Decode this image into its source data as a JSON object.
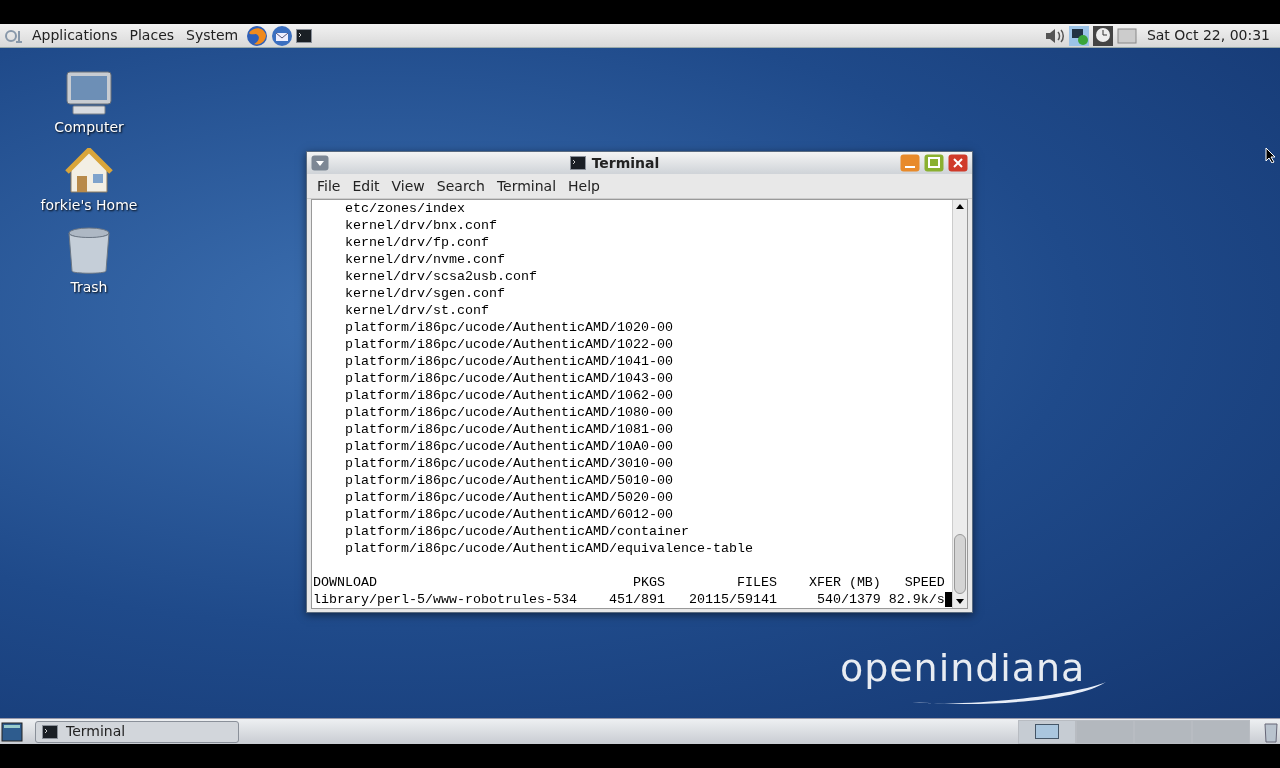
{
  "top_panel": {
    "menus": [
      "Applications",
      "Places",
      "System"
    ],
    "clock": "Sat Oct 22, 00:31"
  },
  "desktop_icons": [
    {
      "kind": "computer",
      "label": "Computer"
    },
    {
      "kind": "home",
      "label": "forkie's Home"
    },
    {
      "kind": "trash",
      "label": "Trash"
    }
  ],
  "terminal": {
    "title": "Terminal",
    "menu": [
      "File",
      "Edit",
      "View",
      "Search",
      "Terminal",
      "Help"
    ],
    "lines": [
      "etc/zones/index",
      "kernel/drv/bnx.conf",
      "kernel/drv/fp.conf",
      "kernel/drv/nvme.conf",
      "kernel/drv/scsa2usb.conf",
      "kernel/drv/sgen.conf",
      "kernel/drv/st.conf",
      "platform/i86pc/ucode/AuthenticAMD/1020-00",
      "platform/i86pc/ucode/AuthenticAMD/1022-00",
      "platform/i86pc/ucode/AuthenticAMD/1041-00",
      "platform/i86pc/ucode/AuthenticAMD/1043-00",
      "platform/i86pc/ucode/AuthenticAMD/1062-00",
      "platform/i86pc/ucode/AuthenticAMD/1080-00",
      "platform/i86pc/ucode/AuthenticAMD/1081-00",
      "platform/i86pc/ucode/AuthenticAMD/10A0-00",
      "platform/i86pc/ucode/AuthenticAMD/3010-00",
      "platform/i86pc/ucode/AuthenticAMD/5010-00",
      "platform/i86pc/ucode/AuthenticAMD/5020-00",
      "platform/i86pc/ucode/AuthenticAMD/6012-00",
      "platform/i86pc/ucode/AuthenticAMD/container",
      "platform/i86pc/ucode/AuthenticAMD/equivalence-table"
    ],
    "status_header": "DOWNLOAD                                PKGS         FILES    XFER (MB)   SPEED",
    "status_line": "library/perl-5/www-robotrules-534    451/891   20115/59141     540/1379 82.9k/s"
  },
  "wallpaper_logo": "openindiana",
  "taskbar": {
    "windows": [
      {
        "label": "Terminal",
        "selected": false
      }
    ],
    "workspaces": [
      {
        "selected": true
      },
      {
        "selected": false
      },
      {
        "selected": false
      },
      {
        "selected": false
      }
    ]
  }
}
